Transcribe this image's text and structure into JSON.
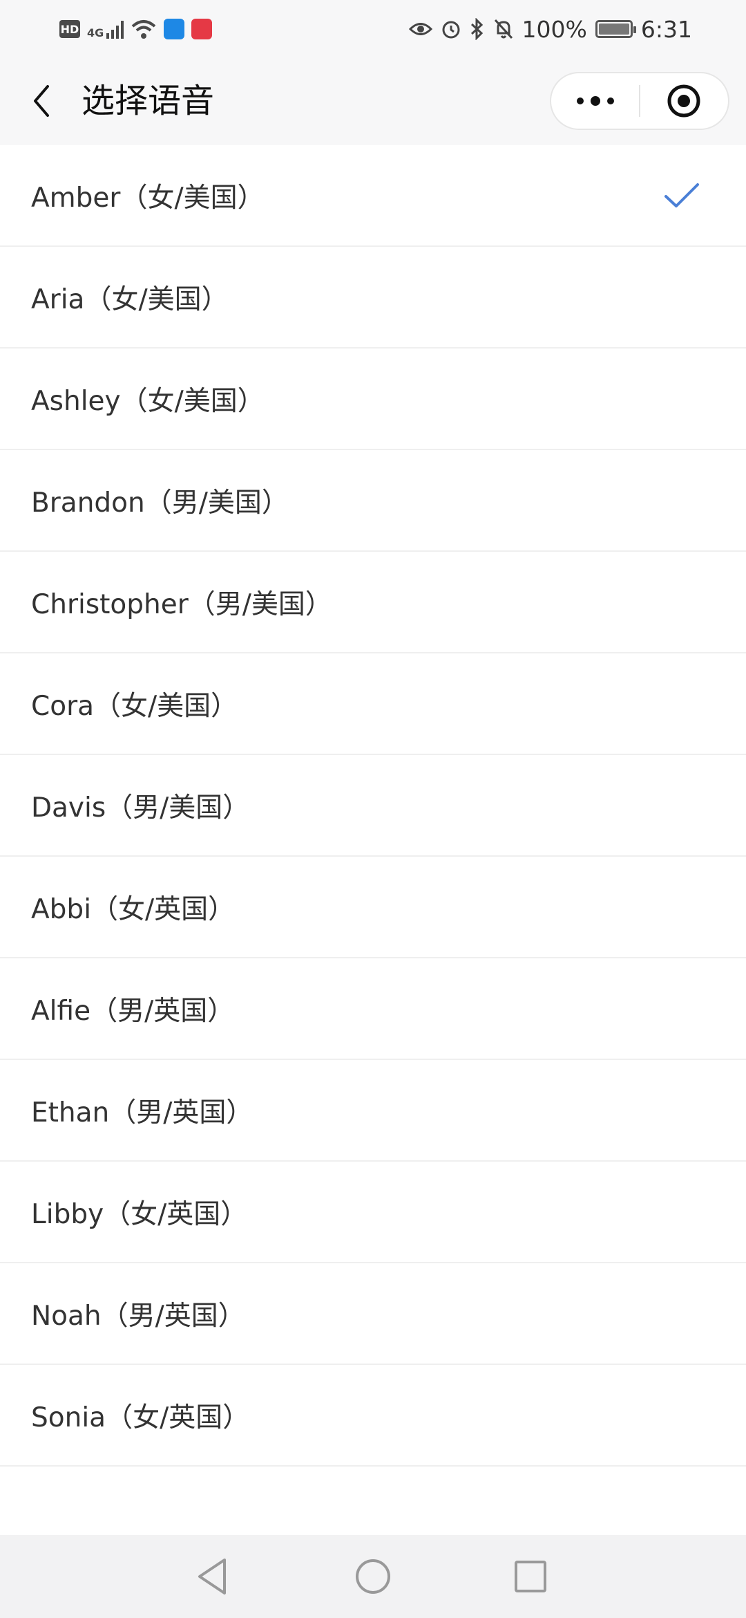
{
  "status_bar": {
    "left_icons": [
      "hd-icon",
      "4g-signal-icon",
      "wifi-icon",
      "shield-app-icon",
      "red-app-icon"
    ],
    "hd_label": "HD",
    "network_label": "4G",
    "right_icons": [
      "eye-icon",
      "alarm-icon",
      "bluetooth-icon",
      "mute-bell-icon",
      "battery-icon"
    ],
    "battery_text": "100%",
    "battery_level": 1.0,
    "time": "6:31"
  },
  "header": {
    "title": "选择语音",
    "back_icon": "chevron-left-icon",
    "capsule": {
      "more_icon": "more-dots-icon",
      "close_icon": "target-close-icon"
    }
  },
  "voices": [
    {
      "label": "Amber（女/美国）",
      "selected": true
    },
    {
      "label": "Aria（女/美国）",
      "selected": false
    },
    {
      "label": "Ashley（女/美国）",
      "selected": false
    },
    {
      "label": "Brandon（男/美国）",
      "selected": false
    },
    {
      "label": "Christopher（男/美国）",
      "selected": false
    },
    {
      "label": "Cora（女/美国）",
      "selected": false
    },
    {
      "label": "Davis（男/美国）",
      "selected": false
    },
    {
      "label": "Abbi（女/英国）",
      "selected": false
    },
    {
      "label": "Alfie（男/英国）",
      "selected": false
    },
    {
      "label": "Ethan（男/英国）",
      "selected": false
    },
    {
      "label": "Libby（女/英国）",
      "selected": false
    },
    {
      "label": "Noah（男/英国）",
      "selected": false
    },
    {
      "label": "Sonia（女/英国）",
      "selected": false
    }
  ],
  "colors": {
    "accent_check": "#4a7fd6",
    "background": "#ffffff",
    "header_bg": "#f7f7f8",
    "divider": "#efefef"
  },
  "nav_bar": {
    "icons": [
      "back-triangle-icon",
      "home-circle-icon",
      "recents-square-icon"
    ]
  }
}
